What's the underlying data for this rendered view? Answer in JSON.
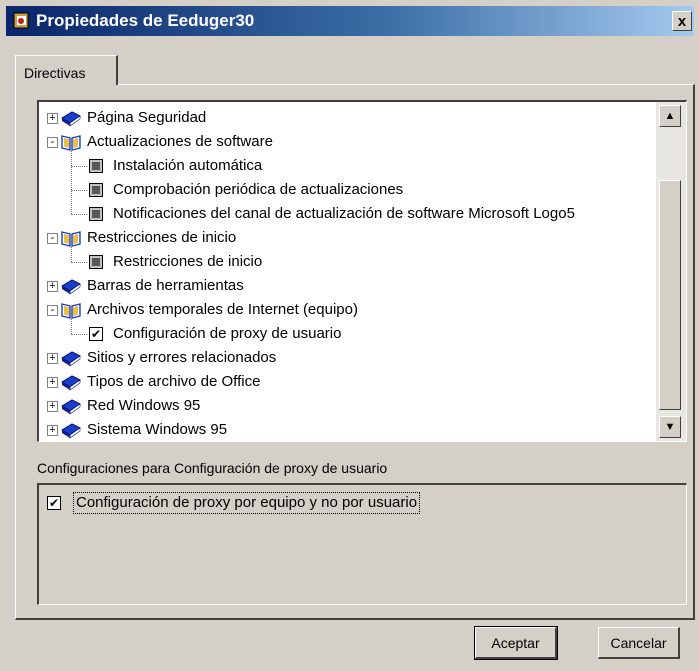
{
  "window": {
    "title": "Propiedades de Eeduger30",
    "close_label": "x"
  },
  "tabs": [
    {
      "label": "Directivas"
    }
  ],
  "tree": {
    "items": [
      {
        "label": "Página Seguridad",
        "level": 0,
        "kind": "closed-book",
        "expander": "+"
      },
      {
        "label": "Actualizaciones de software",
        "level": 0,
        "kind": "open-book",
        "expander": "-"
      },
      {
        "label": "Instalación automática",
        "level": 1,
        "kind": "checkbox",
        "state": "indeterminate"
      },
      {
        "label": "Comprobación periódica de actualizaciones",
        "level": 1,
        "kind": "checkbox",
        "state": "indeterminate"
      },
      {
        "label": "Notificaciones del canal de actualización de software Microsoft Logo5",
        "level": 1,
        "kind": "checkbox",
        "state": "indeterminate"
      },
      {
        "label": "Restricciones de inicio",
        "level": 0,
        "kind": "open-book",
        "expander": "-"
      },
      {
        "label": "Restricciones de inicio",
        "level": 1,
        "kind": "checkbox",
        "state": "indeterminate"
      },
      {
        "label": "Barras de herramientas",
        "level": 0,
        "kind": "closed-book",
        "expander": "+"
      },
      {
        "label": "Archivos temporales de Internet (equipo)",
        "level": 0,
        "kind": "open-book",
        "expander": "-"
      },
      {
        "label": "Configuración de proxy de usuario",
        "level": 1,
        "kind": "checkbox",
        "state": "checked"
      },
      {
        "label": "Sitios y errores relacionados",
        "level": 0,
        "kind": "closed-book",
        "expander": "+"
      },
      {
        "label": "Tipos de archivo de Office",
        "level": 0,
        "kind": "closed-book",
        "expander": "+"
      },
      {
        "label": "Red Windows 95",
        "level": 0,
        "kind": "closed-book",
        "expander": "+"
      },
      {
        "label": "Sistema Windows 95",
        "level": 0,
        "kind": "closed-book",
        "expander": "+"
      }
    ]
  },
  "settings": {
    "heading": "Configuraciones para Configuración de proxy de usuario",
    "items": [
      {
        "label": "Configuración de proxy por equipo y no por usuario",
        "checked": true
      }
    ]
  },
  "buttons": {
    "ok": "Aceptar",
    "cancel": "Cancelar"
  },
  "icons": {
    "app": "app-icon",
    "closed_book": "closed-book-icon",
    "open_book": "open-book-icon",
    "scroll_up": "arrow-up-icon",
    "scroll_down": "arrow-down-icon"
  },
  "colors": {
    "titlebar_start": "#0a246a",
    "titlebar_end": "#a6caf0",
    "face": "#d4d0c8",
    "book_blue": "#1a3cc8",
    "book_open": "#e8c040"
  }
}
